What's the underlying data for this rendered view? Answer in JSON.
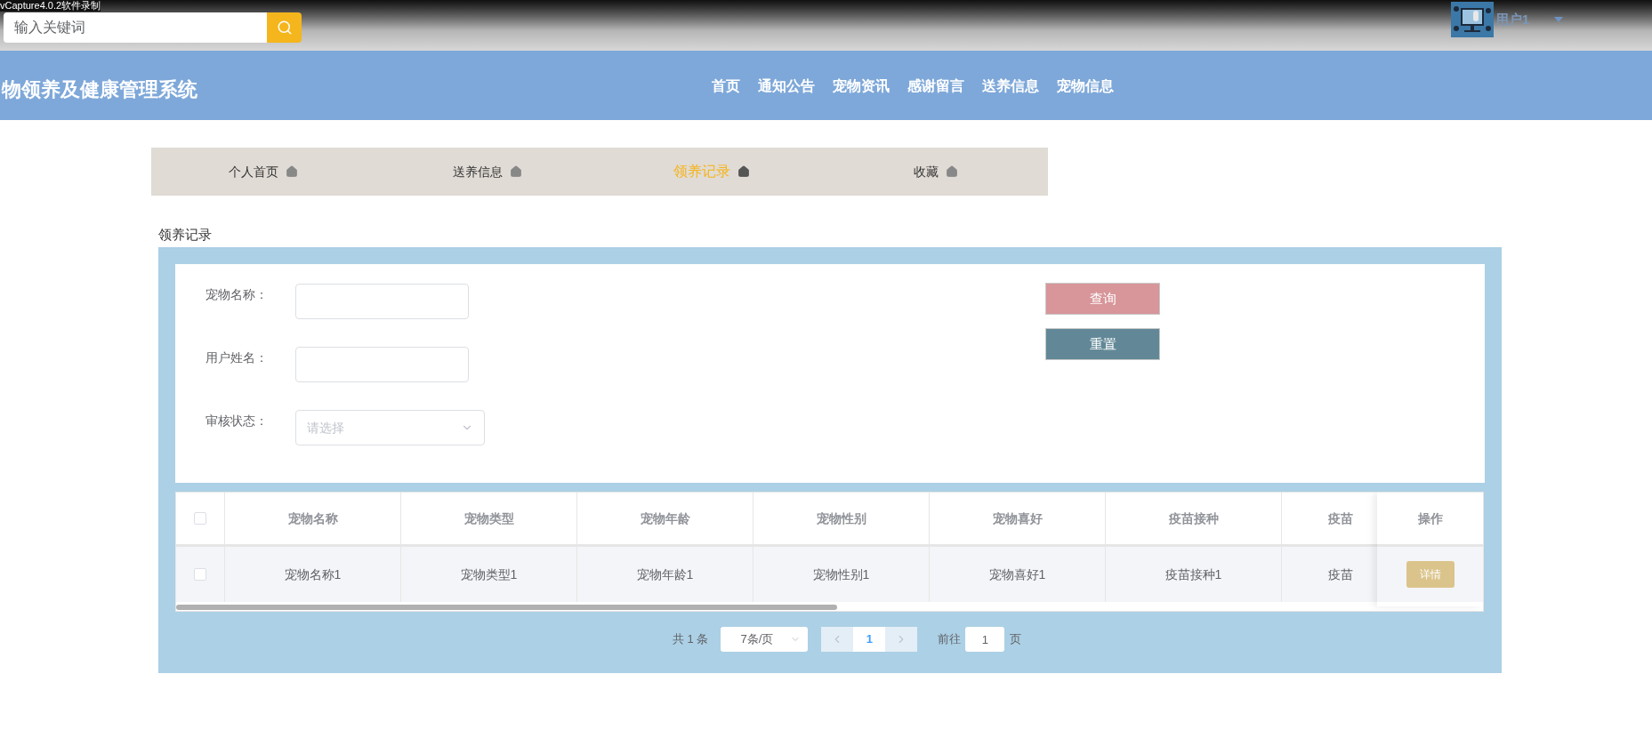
{
  "recorder_caption": "vCapture4.0.2软件录制",
  "top_bar": {
    "search": {
      "placeholder": "输入关键词"
    },
    "user": {
      "name": "用户1"
    }
  },
  "header": {
    "title": "物领养及健康管理系统",
    "nav": [
      {
        "label": "首页"
      },
      {
        "label": "通知公告"
      },
      {
        "label": "宠物资讯"
      },
      {
        "label": "感谢留言"
      },
      {
        "label": "送养信息"
      },
      {
        "label": "宠物信息"
      }
    ]
  },
  "sub_nav": [
    {
      "label": "个人首页",
      "selected": false
    },
    {
      "label": "送养信息",
      "selected": false
    },
    {
      "label": "领养记录",
      "selected": true
    },
    {
      "label": "收藏",
      "selected": false
    }
  ],
  "section_title": "领养记录",
  "filters": [
    {
      "kind": "text",
      "label": "宠物名称："
    },
    {
      "kind": "text",
      "label": "用户姓名："
    },
    {
      "kind": "select",
      "label": "审核状态：",
      "placeholder": "请选择"
    }
  ],
  "buttons": [
    {
      "kind": "query",
      "label": "查询"
    },
    {
      "kind": "reset",
      "label": "重置"
    }
  ],
  "table": {
    "all_checked": false,
    "columns": [
      "宠物名称",
      "宠物类型",
      "宠物年龄",
      "宠物性别",
      "宠物喜好",
      "疫苗接种",
      "疫苗"
    ],
    "action_column": "操作",
    "rows": [
      {
        "checked": false,
        "cells": [
          "宠物名称1",
          "宠物类型1",
          "宠物年龄1",
          "宠物性别1",
          "宠物喜好1",
          "疫苗接种1",
          "疫苗"
        ],
        "action": "详情"
      }
    ]
  },
  "pagination": {
    "total": "共 1 条",
    "page_size": "7条/页",
    "pages": [
      {
        "label": "1",
        "selected": true
      }
    ],
    "goto_label": "前往",
    "goto_value": "1",
    "page_suffix": "页"
  }
}
